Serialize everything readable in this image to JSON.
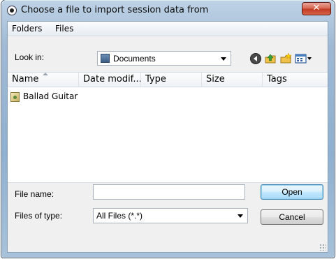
{
  "window": {
    "title": "Choose a file to import session data from",
    "close_symbol": "✕"
  },
  "menu": {
    "items": [
      "Folders",
      "Files"
    ]
  },
  "look_in": {
    "label": "Look in:",
    "value": "Documents"
  },
  "toolbar": {
    "icons": [
      "back-icon",
      "up-folder-icon",
      "new-folder-icon",
      "view-menu-icon"
    ]
  },
  "columns": [
    "Name",
    "Date modif...",
    "Type",
    "Size",
    "Tags"
  ],
  "files": [
    {
      "name": "Ballad Guitar"
    }
  ],
  "file_name": {
    "label": "File name:",
    "value": "",
    "placeholder": ""
  },
  "file_type": {
    "label": "Files of type:",
    "value": "All Files (*.*)"
  },
  "buttons": {
    "open": "Open",
    "cancel": "Cancel"
  },
  "colors": {
    "title_bar": "#9fb9d4",
    "close_button": "#c23b22",
    "open_button": "#bee6fd"
  }
}
